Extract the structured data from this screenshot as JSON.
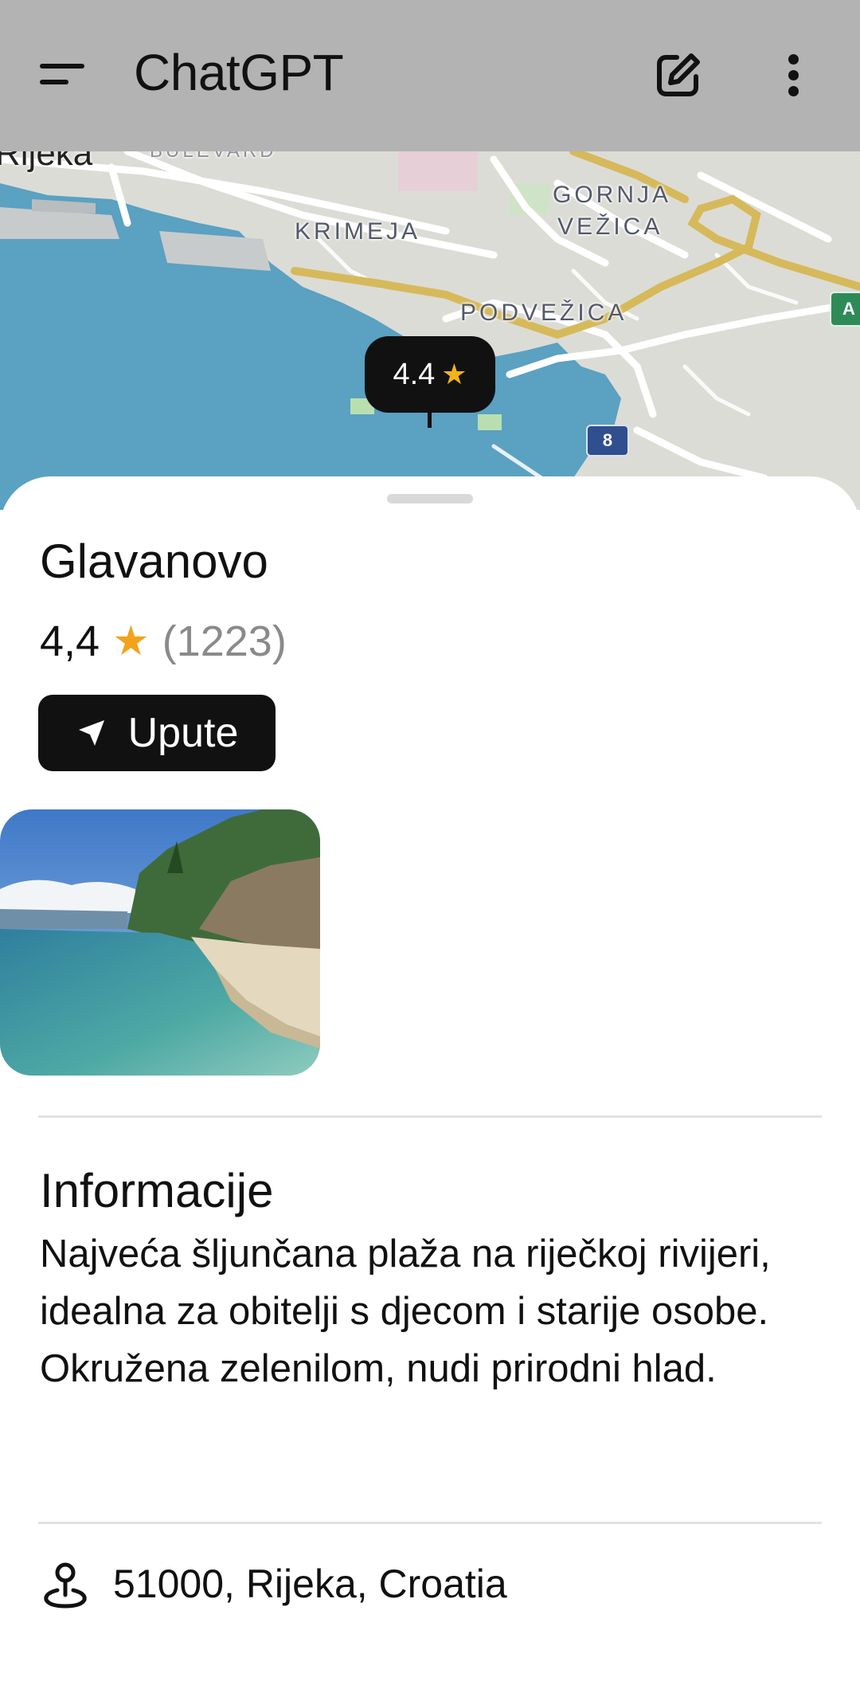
{
  "header": {
    "title": "ChatGPT",
    "menu_icon": "hamburger-menu-icon",
    "edit_icon": "edit-icon",
    "more_icon": "more-vertical-icon"
  },
  "map": {
    "city_label": "Rijeka",
    "street_label": "BULEVARD",
    "areas": [
      "KRIMEJA",
      "GORNJA",
      "VEŽICA",
      "PODVEŽICA"
    ],
    "pin_rating": "4.4",
    "pin_star": "★",
    "route_numbers": [
      "8",
      "A"
    ],
    "colors": {
      "sea": "#5aa1c2",
      "land": "#dcdcd6",
      "highway": "#d6b95a"
    }
  },
  "place": {
    "name": "Glavanovo",
    "rating": "4,4",
    "star": "★",
    "review_count": "(1223)",
    "directions_label": "Upute",
    "directions_icon": "navigation-arrow-icon"
  },
  "info": {
    "heading": "Informacije",
    "description": "Najveća šljunčana plaža na riječkoj rivijeri, idealna za obitelji s djecom i starije osobe. Okružena zelenilom, nudi prirodni hlad."
  },
  "address": {
    "icon": "location-pin-icon",
    "text": "51000, Rijeka, Croatia"
  }
}
